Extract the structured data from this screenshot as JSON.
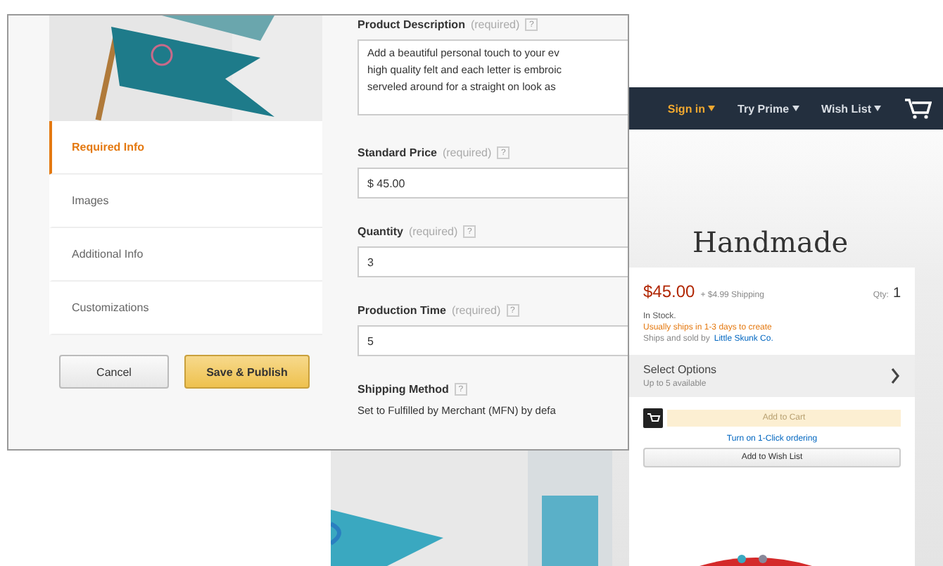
{
  "seller_form": {
    "nav": [
      {
        "label": "Required Info",
        "selected": true
      },
      {
        "label": "Images",
        "selected": false
      },
      {
        "label": "Additional Info",
        "selected": false
      },
      {
        "label": "Customizations",
        "selected": false
      }
    ],
    "buttons": [
      {
        "label": "Cancel",
        "kind": "secondary"
      },
      {
        "label": "Save & Publish",
        "kind": "primary"
      }
    ],
    "fields": [
      {
        "kind": "textarea",
        "label": "Product Description",
        "note": "(required)",
        "help": "?",
        "lines": [
          "Add a beautiful personal touch to your ev",
          "high quality felt and each letter is embroic",
          "serveled around for a straight on look as"
        ]
      },
      {
        "kind": "input",
        "label": "Standard Price",
        "note": "(required)",
        "help": "?",
        "value": "$ 45.00"
      },
      {
        "kind": "input",
        "label": "Quantity",
        "note": "(required)",
        "help": "?",
        "value": "3"
      },
      {
        "kind": "input",
        "label": "Production Time",
        "note": "(required)",
        "help": "?",
        "value": "5"
      },
      {
        "kind": "text",
        "label": "Shipping Method",
        "help": "?",
        "value": "Set to Fulfilled by Merchant (MFN) by defa"
      }
    ]
  },
  "product_page": {
    "nav": [
      {
        "label": "Sign in",
        "highlighted": true
      },
      {
        "label": "Try Prime",
        "highlighted": false
      },
      {
        "label": "Wish List",
        "highlighted": false
      }
    ],
    "title": "Handmade",
    "price": "$45.00",
    "shipping": "+ $4.99 Shipping",
    "qty_label": "Qty:",
    "qty_value": "1",
    "availability": "In Stock.",
    "ships_note": "Usually ships in 1-3 days to create",
    "sold_by": "Ships and sold by",
    "seller": "Little Skunk Co.",
    "options": {
      "title": "Select Options",
      "subtitle": "Up to 5 available"
    },
    "add_to_cart": "Add to Cart",
    "one_click": "Turn on 1-Click ordering",
    "wish_list": "Add to Wish List"
  }
}
